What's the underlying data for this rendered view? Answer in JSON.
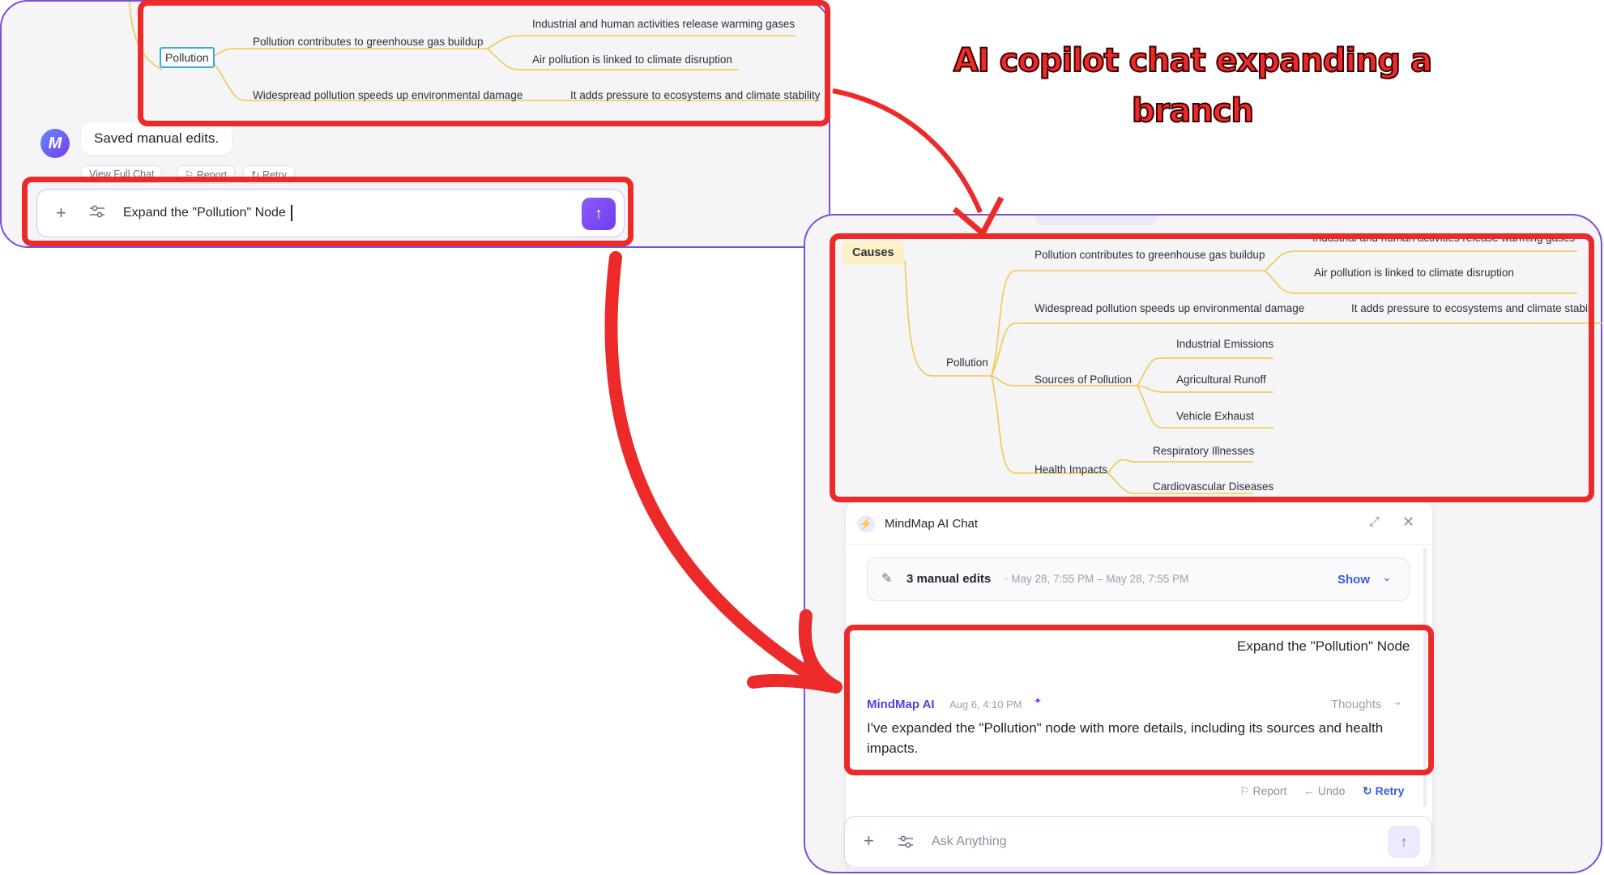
{
  "title": "AI copilot chat expanding a branch",
  "panel_a": {
    "node_pollution": "Pollution",
    "branch_1": "Pollution contributes to greenhouse gas buildup",
    "branch_1_leaf_1": "Industrial and human activities release warming gases",
    "branch_1_leaf_2": "Air pollution is linked to climate disruption",
    "branch_2": "Widespread pollution speeds up environmental damage",
    "branch_2_leaf_1": "It adds pressure to ecosystems and climate stability",
    "ai_message": "Saved manual edits.",
    "btn_view_full_chat": "View Full Chat",
    "btn_report": "Report",
    "btn_retry": "Retry",
    "input_value": "Expand the \"Pollution\" Node"
  },
  "panel_b": {
    "causes": "Causes",
    "b1": "Pollution contributes to greenhouse gas buildup",
    "b1_leaf_top": "Industrial and human activities release warming gases",
    "b1_leaf_2": "Air pollution is linked to climate disruption",
    "b2": "Widespread pollution speeds up environmental damage",
    "b2_leaf": "It adds pressure to ecosystems and climate stabili",
    "pollution": "Pollution",
    "sources": "Sources of Pollution",
    "src_1": "Industrial Emissions",
    "src_2": "Agricultural Runoff",
    "src_3": "Vehicle Exhaust",
    "health": "Health Impacts",
    "h_1": "Respiratory Illnesses",
    "h_2": "Cardiovascular Diseases"
  },
  "chat": {
    "header_title": "MindMap AI Chat",
    "edits_label": "3 manual edits",
    "edits_range": "· May 28, 7:55 PM – May 28, 7:55 PM",
    "show_label": "Show",
    "user_message": "Expand the \"Pollution\" Node",
    "ai_name": "MindMap AI",
    "ai_time": "Aug 6, 4:10 PM",
    "thoughts_label": "Thoughts",
    "ai_reply": "I've expanded the \"Pollution\" node with more details, including its sources and health impacts.",
    "btn_report": "Report",
    "btn_undo": "Undo",
    "btn_retry": "Retry",
    "input_placeholder": "Ask Anything"
  },
  "colors": {
    "accent_purple": "#7b4fd6",
    "highlight_red": "#ec2a2a",
    "branch_yellow": "#f2c94c",
    "causes_bg": "#fdf0c4"
  }
}
